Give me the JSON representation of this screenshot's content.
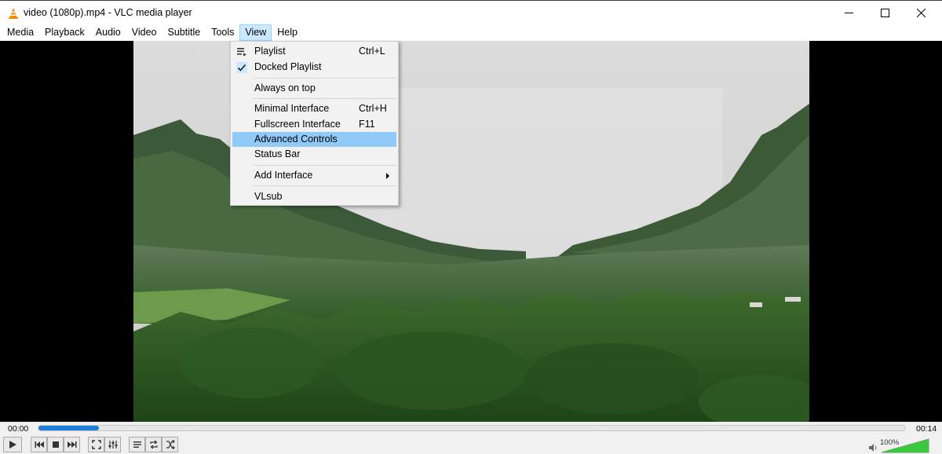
{
  "window": {
    "title": "video (1080p).mp4 - VLC media player",
    "accent": "#cce8ff"
  },
  "menubar": {
    "items": [
      {
        "label": "Media"
      },
      {
        "label": "Playback"
      },
      {
        "label": "Audio"
      },
      {
        "label": "Video"
      },
      {
        "label": "Subtitle"
      },
      {
        "label": "Tools"
      },
      {
        "label": "View",
        "open": true
      },
      {
        "label": "Help"
      }
    ]
  },
  "view_menu": {
    "items": [
      {
        "label": "Playlist",
        "shortcut": "Ctrl+L",
        "icon": "playlist-icon"
      },
      {
        "label": "Docked Playlist",
        "shortcut": "",
        "icon": "check-icon",
        "checked": true
      },
      {
        "label": "Always on top",
        "shortcut": ""
      },
      {
        "label": "Minimal Interface",
        "shortcut": "Ctrl+H"
      },
      {
        "label": "Fullscreen Interface",
        "shortcut": "F11"
      },
      {
        "label": "Advanced Controls",
        "shortcut": "",
        "highlighted": true
      },
      {
        "label": "Status Bar",
        "shortcut": ""
      },
      {
        "label": "Add Interface",
        "shortcut": "",
        "submenu": true
      },
      {
        "label": "VLsub",
        "shortcut": ""
      }
    ],
    "highlight_color": "#91c9f7"
  },
  "player": {
    "time_elapsed": "00:00",
    "time_total": "00:14",
    "progress": 0.07,
    "progress_color": "#1f7fd8",
    "volume_label": "100%",
    "volume_level": 1.0,
    "volume_color": "#3cc83c",
    "buttons": [
      "play-icon",
      "previous-icon",
      "stop-icon",
      "next-icon",
      "fullscreen-icon",
      "extended-settings-icon",
      "playlist-toggle-icon",
      "loop-icon",
      "shuffle-icon"
    ]
  }
}
